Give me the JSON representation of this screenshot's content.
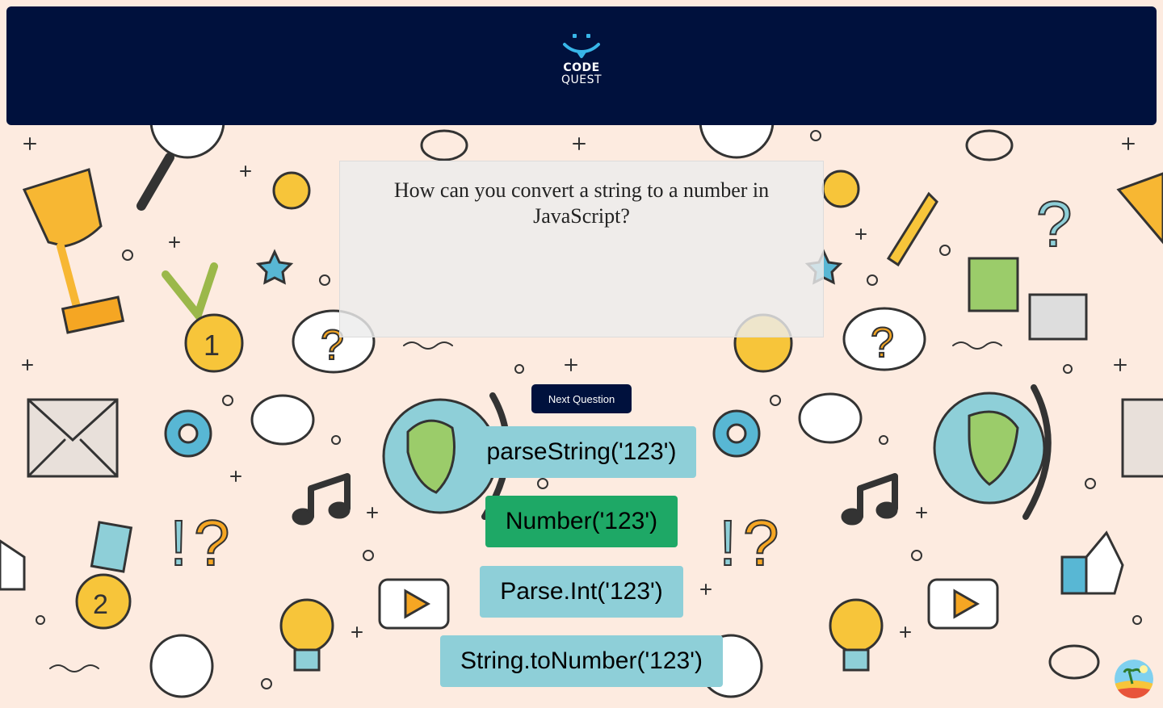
{
  "header": {
    "logo_line1": "CODE",
    "logo_line2": "QUEST"
  },
  "question": {
    "text": "How can you convert a string to a number in JavaScript?"
  },
  "next_button": "Next Question",
  "options": [
    {
      "label": "parseString('123')",
      "state": "default"
    },
    {
      "label": "Number('123')",
      "state": "correct"
    },
    {
      "label": "Parse.Int('123')",
      "state": "default"
    },
    {
      "label": "String.toNumber('123')",
      "state": "default"
    }
  ],
  "colors": {
    "header_bg": "#00113d",
    "logo_accent": "#38b6e8",
    "page_bg": "#fdebe0",
    "option_default": "#8ecfd8",
    "option_correct": "#1ea866"
  },
  "icons": [
    "logo-icon",
    "trophy-icon",
    "medal-icon",
    "globe-icon",
    "envelope-icon",
    "gear-icon",
    "music-note-icon",
    "question-bubble-icon",
    "lightbulb-icon",
    "play-icon",
    "pencil-icon",
    "puzzle-icon",
    "magnifier-icon",
    "glasses-icon",
    "thumbs-up-icon",
    "smiley-icon",
    "star-icon",
    "avatar-icon"
  ]
}
